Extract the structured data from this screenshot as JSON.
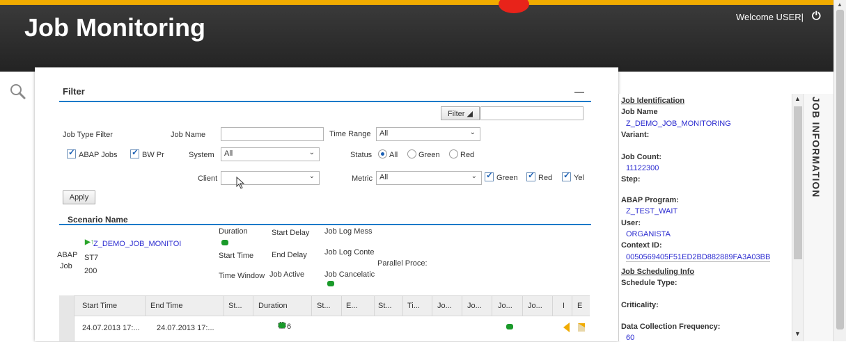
{
  "header": {
    "title": "Job Monitoring",
    "welcome": "Welcome USER|",
    "power_icon": "power-icon"
  },
  "filter": {
    "title": "Filter",
    "filter_button": "Filter",
    "job_type_filter_label": "Job Type Filter",
    "abap_jobs": "ABAP Jobs",
    "bw_pr": "BW Pr",
    "job_name_label": "Job Name",
    "job_name_value": "",
    "time_range_label": "Time Range",
    "time_range_value": "All",
    "system_label": "System",
    "system_value": "All",
    "status_label": "Status",
    "status_all": "All",
    "status_green": "Green",
    "status_red": "Red",
    "client_label": "Client",
    "client_value": "",
    "metric_label": "Metric",
    "metric_value": "All",
    "metric_green": "Green",
    "metric_red": "Red",
    "metric_yel": "Yel",
    "apply": "Apply"
  },
  "scenario": {
    "title": "Scenario Name",
    "job_type": "ABAP",
    "job_word": "Job",
    "name": "Z_DEMO_JOB_MONITOI",
    "system": "ST7",
    "client": "200",
    "duration_label": "Duration",
    "start_delay_label": "Start Delay",
    "job_log_mess_label": "Job Log Mess",
    "start_time_label": "Start Time",
    "end_delay_label": "End Delay",
    "job_log_conte_label": "Job Log Conte",
    "parallel_label": "Parallel Proce:",
    "time_window_label": "Time Window",
    "job_active_label": "Job Active",
    "job_cancel_label": "Job Cancelatic"
  },
  "grid": {
    "headers": [
      "Start Time",
      "End Time",
      "St...",
      "Duration",
      "St...",
      "E...",
      "St...",
      "Ti...",
      "Jo...",
      "Jo...",
      "Jo...",
      "Jo...",
      "I",
      "E"
    ],
    "row": {
      "start": "24.07.2013 17:...",
      "end": "24.07.2013 17:...",
      "duration_val": "6"
    }
  },
  "job_info": {
    "tab_label": "JOB INFORMATION",
    "job_identification": "Job Identification",
    "job_name_label": "Job Name",
    "job_name": "Z_DEMO_JOB_MONITORING",
    "variant_label": "Variant:",
    "job_count_label": "Job Count:",
    "job_count": "11122300",
    "step_label": "Step:",
    "abap_program_label": "ABAP Program:",
    "abap_program": "Z_TEST_WAIT",
    "user_label": "User:",
    "user": "ORGANISTA",
    "context_id_label": "Context ID:",
    "context_id": "0050569405F51ED2BD882889FA3A03BB",
    "scheduling_info": "Job Scheduling Info",
    "schedule_type_label": "Schedule Type:",
    "criticality_label": "Criticality:",
    "frequency_label": "Data Collection Frequency:",
    "frequency": "60"
  },
  "colors": {
    "accent": "#f0ab00",
    "header_bg": "#2b2b2b",
    "link": "#2b2bd0",
    "rule": "#1a7ac9",
    "status_green": "#1a9a2a",
    "alert_red": "#e8231a"
  }
}
